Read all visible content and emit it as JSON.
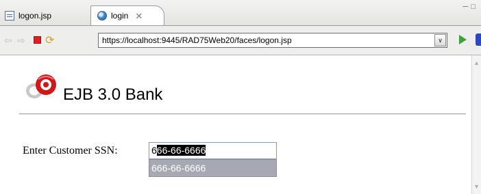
{
  "tabs": [
    {
      "label": "logon.jsp",
      "icon": "jsp-file-icon"
    },
    {
      "label": "login",
      "icon": "globe-icon",
      "close": "✕"
    }
  ],
  "toolbar": {
    "url": "https://localhost:9445/RAD75Web20/faces/logon.jsp",
    "dropdown": "∨"
  },
  "page": {
    "title": "EJB 3.0 Bank",
    "ssn_label": "Enter Customer SSN:",
    "ssn_typed": "6",
    "ssn_completion": "66-66-6666",
    "suggestion": "666-66-6666"
  },
  "colors": {
    "stop": "#e02020",
    "go": "#3aa23a",
    "suggestion_bg": "#a8a8b4",
    "input_border": "#7f9db9"
  }
}
